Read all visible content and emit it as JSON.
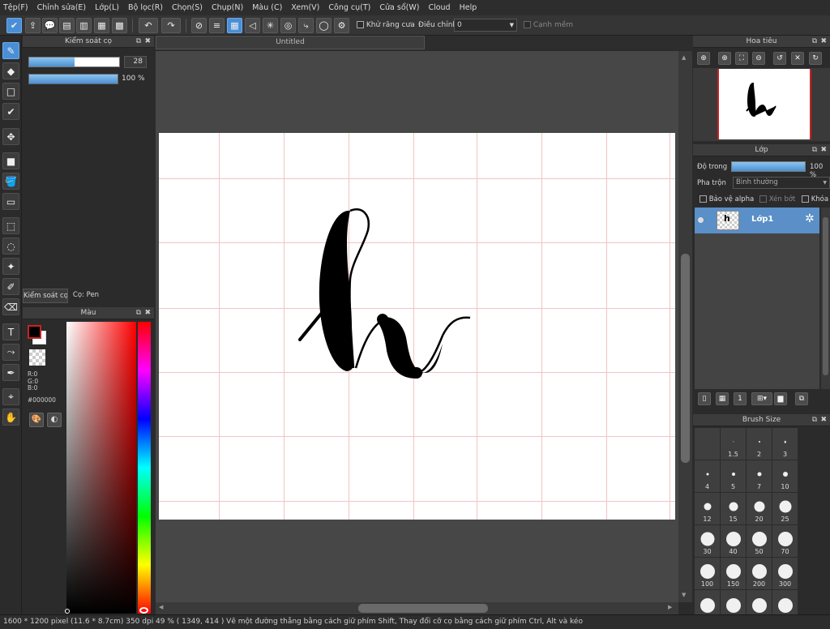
{
  "menu": [
    "Tệp(F)",
    "Chỉnh sửa(E)",
    "Lớp(L)",
    "Bộ lọc(R)",
    "Chọn(S)",
    "Chụp(N)",
    "Màu (C)",
    "Xem(V)",
    "Công cụ(T)",
    "Cửa sổ(W)",
    "Cloud",
    "Help"
  ],
  "toolbar": {
    "antialias_label": "Khử răng cưa",
    "correction_label": "Điều chỉnh",
    "correction_value": "0",
    "soft_edge_label": "Cạnh mềm"
  },
  "brush_panel": {
    "title": "Kiểm soát cọ",
    "size_value": "28",
    "size_fraction": 0.5,
    "opacity_value": "100 %",
    "opacity_fraction": 1.0,
    "tab_control": "Kiểm soát cọ",
    "tab_pen": "Cọ: Pen"
  },
  "color_panel": {
    "title": "Màu",
    "r": "R:0",
    "g": "G:0",
    "b": "B:0",
    "hex": "#000000",
    "fg_color": "#000000",
    "bg_color": "#ffffff"
  },
  "document": {
    "tab_title": "Untitled"
  },
  "navigator": {
    "title": "Hoa tiêu"
  },
  "layers": {
    "title": "Lớp",
    "opacity_label": "Độ trong",
    "opacity_value": "100 %",
    "opacity_fraction": 1.0,
    "blend_label": "Pha trộn",
    "blend_value": "Bình thường",
    "protect_alpha": "Bảo vệ alpha",
    "clipping": "Xén bớt",
    "lock": "Khóa",
    "layer_name": "Lớp1"
  },
  "brush_size": {
    "title": "Brush Size",
    "sizes": [
      "",
      "1.5",
      "2",
      "3",
      "4",
      "5",
      "7",
      "10",
      "12",
      "15",
      "20",
      "25",
      "30",
      "40",
      "50",
      "70",
      "100",
      "150",
      "200",
      "300",
      "",
      "",
      "",
      ""
    ]
  },
  "status": {
    "text": "1600 * 1200 pixel   (11.6 * 8.7cm)   350 dpi   49 %   ( 1349, 414 )   Vẽ một đường thẳng bằng cách giữ phím Shift, Thay đổi cỡ cọ bằng cách giữ phím Ctrl, Alt và kéo"
  }
}
